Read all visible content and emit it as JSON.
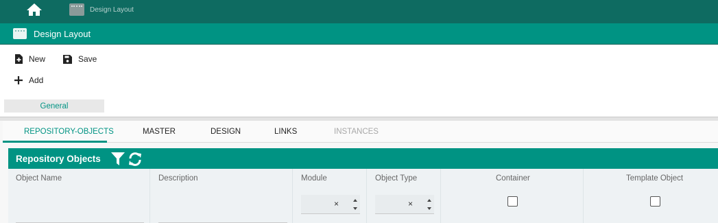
{
  "topbar": {
    "home_icon": "home-icon",
    "tab_label": "Design Layout",
    "tab_icon": "window-icon"
  },
  "titlebar": {
    "title": "Design Layout",
    "icon": "window-icon"
  },
  "toolbar": {
    "new_label": "New",
    "save_label": "Save",
    "add_label": "Add",
    "section_label": "General"
  },
  "tabs": [
    {
      "label": "REPOSITORY-OBJECTS",
      "state": "active"
    },
    {
      "label": "MASTER",
      "state": "normal"
    },
    {
      "label": "DESIGN",
      "state": "normal"
    },
    {
      "label": "LINKS",
      "state": "normal"
    },
    {
      "label": "INSTANCES",
      "state": "disabled"
    }
  ],
  "panel": {
    "title": "Repository Objects",
    "icons": [
      "filter-icon",
      "refresh-icon"
    ]
  },
  "columns": {
    "object_name": "Object Name",
    "description": "Description",
    "module": "Module",
    "object_type": "Object Type",
    "container": "Container",
    "template_object": "Template Object",
    "clear_symbol": "×"
  },
  "colors": {
    "accent": "#009383",
    "topbar": "#0e6b61"
  }
}
